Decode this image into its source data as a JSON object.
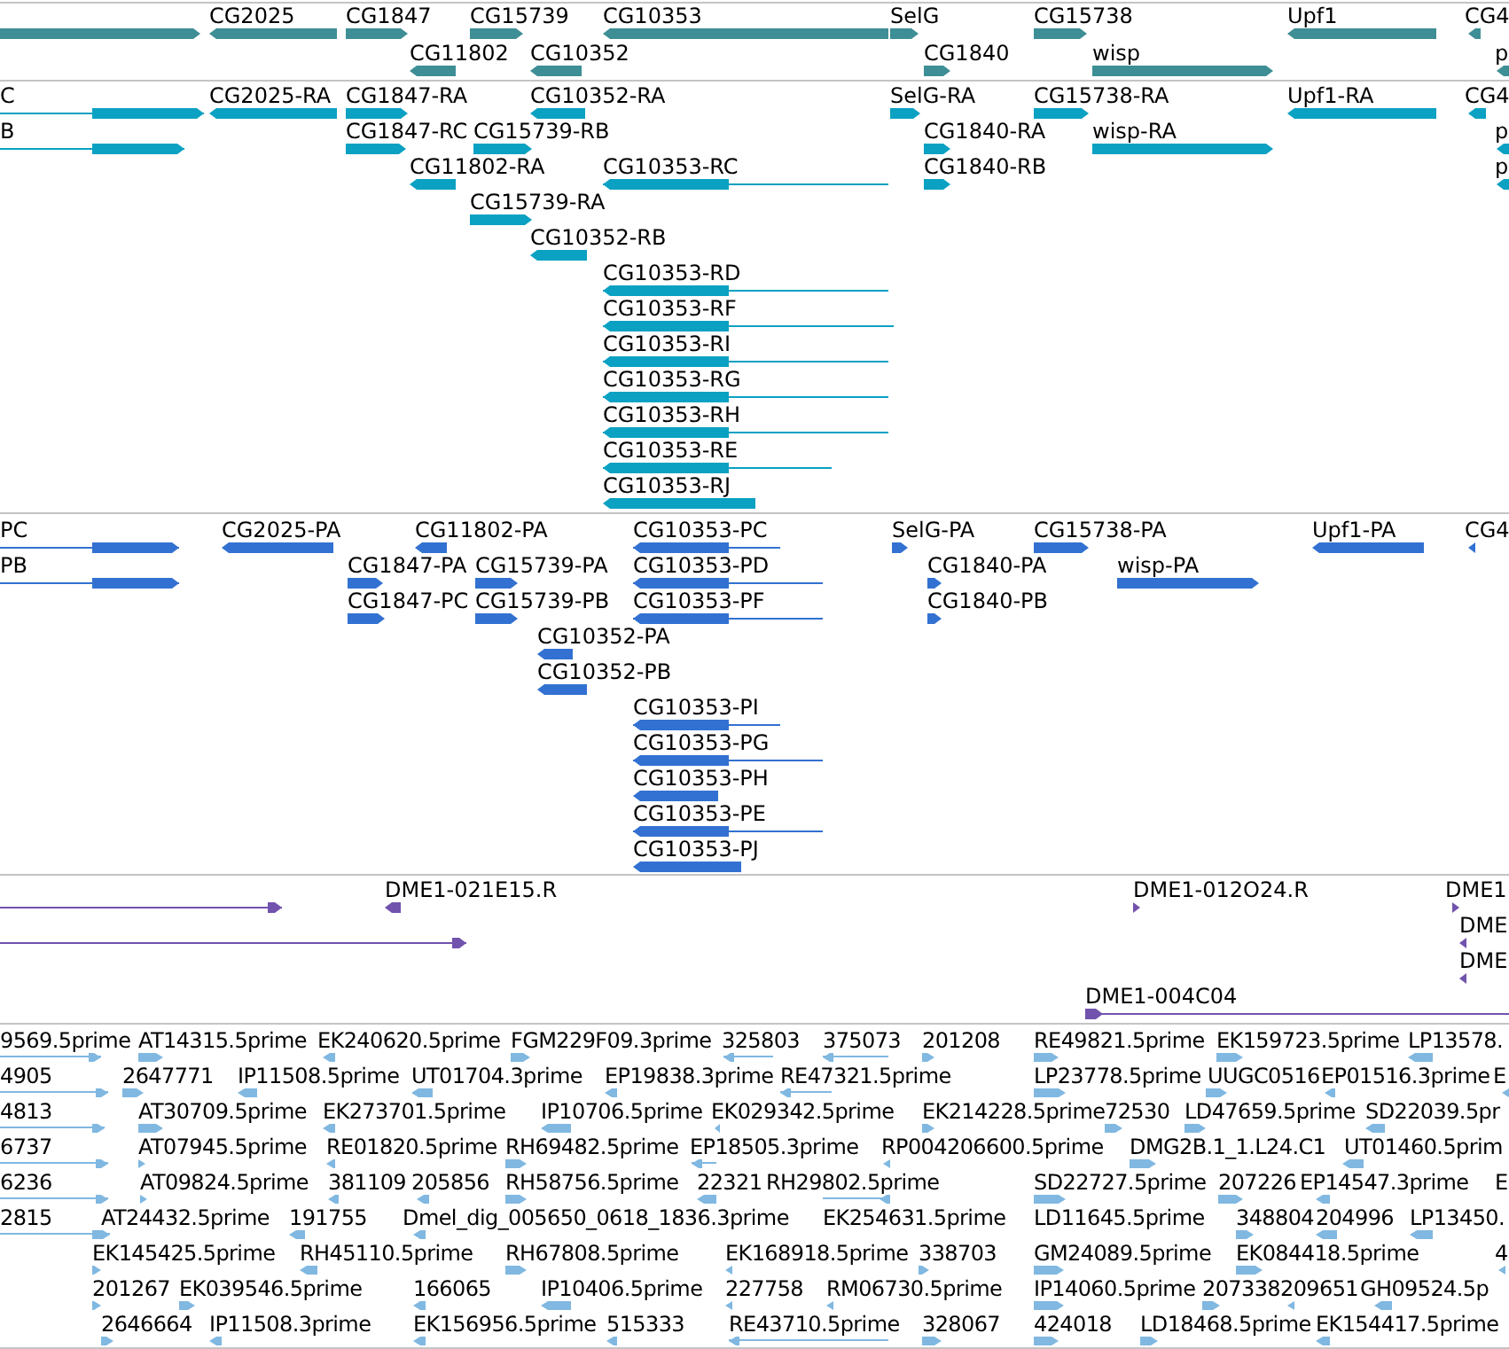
{
  "tracks": [
    {
      "kind": "gene",
      "rows": [
        {
          "features": [
            {
              "reverse": false
            },
            {
              "label": "CG2025",
              "reverse": true
            },
            {
              "label": "CG1847",
              "reverse": false
            },
            {
              "label": "CG15739",
              "reverse": false
            },
            {
              "label": "CG10353",
              "reverse": true
            },
            {
              "label": "SelG",
              "reverse": false
            },
            {
              "label": "CG15738",
              "reverse": false
            },
            {
              "label": "Upf1",
              "reverse": true
            },
            {
              "label": "CG4",
              "reverse": true
            }
          ]
        },
        {
          "features": [
            {
              "label": "CG11802",
              "reverse": true
            },
            {
              "label": "CG10352",
              "reverse": true
            },
            {
              "label": "CG1840",
              "reverse": false
            },
            {
              "label": "wisp",
              "reverse": false
            },
            {
              "label": "p",
              "reverse": true
            }
          ]
        }
      ]
    },
    {
      "kind": "transcript",
      "rows": [
        {
          "features": [
            {
              "label": "C",
              "reverse": false
            },
            {
              "label": "CG2025-RA",
              "reverse": true
            },
            {
              "label": "CG1847-RA",
              "reverse": false
            },
            {
              "label": "CG10352-RA",
              "reverse": true
            },
            {
              "label": "SelG-RA",
              "reverse": false
            },
            {
              "label": "CG15738-RA",
              "reverse": false
            },
            {
              "label": "Upf1-RA",
              "reverse": true
            },
            {
              "label": "CG4",
              "reverse": true
            }
          ]
        },
        {
          "features": [
            {
              "label": "B",
              "reverse": false
            },
            {
              "label": "CG1847-RC",
              "reverse": false
            },
            {
              "label": "CG15739-RB",
              "reverse": false
            },
            {
              "label": "CG1840-RA",
              "reverse": false
            },
            {
              "label": "wisp-RA",
              "reverse": false
            },
            {
              "label": "p",
              "reverse": true
            }
          ]
        },
        {
          "features": [
            {
              "label": "CG11802-RA",
              "reverse": true
            },
            {
              "label": "CG10353-RC",
              "reverse": true
            },
            {
              "label": "CG1840-RB",
              "reverse": false
            },
            {
              "label": "p",
              "reverse": true
            }
          ]
        },
        {
          "features": [
            {
              "label": "CG15739-RA",
              "reverse": false
            }
          ]
        },
        {
          "features": [
            {
              "label": "CG10352-RB",
              "reverse": true
            }
          ]
        },
        {
          "features": [
            {
              "label": "CG10353-RD",
              "reverse": true
            }
          ]
        },
        {
          "features": [
            {
              "label": "CG10353-RF",
              "reverse": true
            }
          ]
        },
        {
          "features": [
            {
              "label": "CG10353-RI",
              "reverse": true
            }
          ]
        },
        {
          "features": [
            {
              "label": "CG10353-RG",
              "reverse": true
            }
          ]
        },
        {
          "features": [
            {
              "label": "CG10353-RH",
              "reverse": true
            }
          ]
        },
        {
          "features": [
            {
              "label": "CG10353-RE",
              "reverse": true
            }
          ]
        },
        {
          "features": [
            {
              "label": "CG10353-RJ",
              "reverse": true
            }
          ]
        }
      ]
    },
    {
      "kind": "protein",
      "rows": [
        {
          "features": [
            {
              "label": "PC",
              "reverse": false
            },
            {
              "label": "CG2025-PA",
              "reverse": true
            },
            {
              "label": "CG11802-PA",
              "reverse": true
            },
            {
              "label": "CG10353-PC",
              "reverse": true
            },
            {
              "label": "SelG-PA",
              "reverse": false
            },
            {
              "label": "CG15738-PA",
              "reverse": false
            },
            {
              "label": "Upf1-PA",
              "reverse": true
            },
            {
              "label": "CG4",
              "reverse": true
            }
          ]
        },
        {
          "features": [
            {
              "label": "PB",
              "reverse": false
            },
            {
              "label": "CG1847-PA",
              "reverse": false
            },
            {
              "label": "CG15739-PA",
              "reverse": false
            },
            {
              "label": "CG10353-PD",
              "reverse": true
            },
            {
              "label": "CG1840-PA",
              "reverse": false
            },
            {
              "label": "wisp-PA",
              "reverse": false
            }
          ]
        },
        {
          "features": [
            {
              "label": "CG1847-PC",
              "reverse": false
            },
            {
              "label": "CG15739-PB",
              "reverse": false
            },
            {
              "label": "CG10353-PF",
              "reverse": true
            },
            {
              "label": "CG1840-PB",
              "reverse": false
            }
          ]
        },
        {
          "features": [
            {
              "label": "CG10352-PA",
              "reverse": true
            }
          ]
        },
        {
          "features": [
            {
              "label": "CG10352-PB",
              "reverse": true
            }
          ]
        },
        {
          "features": [
            {
              "label": "CG10353-PI",
              "reverse": true
            }
          ]
        },
        {
          "features": [
            {
              "label": "CG10353-PG",
              "reverse": true
            }
          ]
        },
        {
          "features": [
            {
              "label": "CG10353-PH",
              "reverse": true
            }
          ]
        },
        {
          "features": [
            {
              "label": "CG10353-PE",
              "reverse": true
            }
          ]
        },
        {
          "features": [
            {
              "label": "CG10353-PJ",
              "reverse": true
            }
          ]
        }
      ]
    },
    {
      "kind": "clone_end",
      "rows": [
        {
          "features": [
            {
              "reverse": false
            },
            {
              "label": "DME1-021E15.R",
              "reverse": true
            },
            {
              "label": "DME1-012O24.R",
              "reverse": false
            },
            {
              "label": "DME1",
              "reverse": false
            }
          ]
        },
        {
          "features": [
            {
              "reverse": false
            },
            {
              "label": "DME",
              "reverse": true
            }
          ]
        },
        {
          "features": [
            {
              "label": "DME",
              "reverse": true
            }
          ]
        },
        {
          "features": [
            {
              "label": "DME1-004C04",
              "reverse": false
            }
          ]
        }
      ]
    },
    {
      "kind": "est",
      "rows": [
        {
          "features": [
            {
              "label": "9569.5prime",
              "reverse": false
            },
            {
              "label": "AT14315.5prime",
              "reverse": false
            },
            {
              "label": "EK240620.5prime",
              "reverse": true
            },
            {
              "label": "FGM229F09.3prime",
              "reverse": false
            },
            {
              "label": "325803",
              "reverse": true
            },
            {
              "label": "375073",
              "reverse": true
            },
            {
              "label": "201208",
              "reverse": false
            },
            {
              "label": "RE49821.5prime",
              "reverse": false
            },
            {
              "label": "EK159723.5prime",
              "reverse": false
            },
            {
              "label": "LP13578.",
              "reverse": true
            }
          ]
        },
        {
          "features": [
            {
              "label": "4905",
              "reverse": false
            },
            {
              "label": "2647771",
              "reverse": false
            },
            {
              "label": "IP11508.5prime",
              "reverse": true
            },
            {
              "label": "UT01704.3prime",
              "reverse": true
            },
            {
              "label": "EP19838.3prime",
              "reverse": true
            },
            {
              "label": "RE47321.5prime",
              "reverse": true
            },
            {
              "label": "LP23778.5prime",
              "reverse": false
            },
            {
              "label": "UUGC0516",
              "reverse": false
            },
            {
              "label": "EP01516.3prime",
              "reverse": true
            },
            {
              "label": "E",
              "reverse": true
            }
          ]
        },
        {
          "features": [
            {
              "label": "4813",
              "reverse": false
            },
            {
              "label": "AT30709.5prime",
              "reverse": false
            },
            {
              "label": "EK273701.5prime",
              "reverse": true
            },
            {
              "label": "IP10706.5prime",
              "reverse": true
            },
            {
              "label": "EK029342.5prime",
              "reverse": true
            },
            {
              "label": "EK214228.5prime",
              "reverse": false
            },
            {
              "label": "72530",
              "reverse": false
            },
            {
              "label": "LD47659.5prime",
              "reverse": false
            },
            {
              "label": "SD22039.5pr",
              "reverse": true
            }
          ]
        },
        {
          "features": [
            {
              "label": "6737",
              "reverse": false
            },
            {
              "label": "AT07945.5prime",
              "reverse": false
            },
            {
              "label": "RE01820.5prime",
              "reverse": true
            },
            {
              "label": "RH69482.5prime",
              "reverse": false
            },
            {
              "label": "EP18505.3prime",
              "reverse": true
            },
            {
              "label": "RP004206600.5prime",
              "reverse": true
            },
            {
              "label": "DMG2B.1_1.L24.C1",
              "reverse": false
            },
            {
              "label": "UT01460.5prim",
              "reverse": true
            }
          ]
        },
        {
          "features": [
            {
              "label": "6236",
              "reverse": false
            },
            {
              "label": "AT09824.5prime",
              "reverse": false
            },
            {
              "label": "381109",
              "reverse": true
            },
            {
              "label": "205856",
              "reverse": true
            },
            {
              "label": "RH58756.5prime",
              "reverse": false
            },
            {
              "label": "22321",
              "reverse": true
            },
            {
              "label": "RH29802.5prime",
              "reverse": true
            },
            {
              "label": "SD22727.5prime",
              "reverse": false
            },
            {
              "label": "207226",
              "reverse": false
            },
            {
              "label": "EP14547.3prime",
              "reverse": true
            },
            {
              "label": "E"
            }
          ]
        },
        {
          "features": [
            {
              "label": "2815",
              "reverse": false
            },
            {
              "label": "AT24432.5prime"
            },
            {
              "label": "191755",
              "reverse": true
            },
            {
              "label": "Dmel_dig_005650_0618_1836.3prime",
              "reverse": true
            },
            {
              "label": "EK254631.5prime"
            },
            {
              "label": "LD11645.5prime"
            },
            {
              "label": "348804",
              "reverse": false
            },
            {
              "label": "204996",
              "reverse": true
            },
            {
              "label": "LP13450.",
              "reverse": true
            }
          ]
        },
        {
          "features": [
            {
              "label": "EK145425.5prime",
              "reverse": false
            },
            {
              "label": "RH45110.5prime",
              "reverse": true
            },
            {
              "label": "RH67808.5prime",
              "reverse": false
            },
            {
              "label": "EK168918.5prime",
              "reverse": true
            },
            {
              "label": "338703",
              "reverse": false
            },
            {
              "label": "GM24089.5prime",
              "reverse": false
            },
            {
              "label": "EK084418.5prime",
              "reverse": false
            },
            {
              "label": "4",
              "reverse": true
            }
          ]
        },
        {
          "features": [
            {
              "label": "201267",
              "reverse": false
            },
            {
              "label": "EK039546.5prime",
              "reverse": false
            },
            {
              "label": "166065",
              "reverse": true
            },
            {
              "label": "IP10406.5prime",
              "reverse": true
            },
            {
              "label": "227758",
              "reverse": true
            },
            {
              "label": "RM06730.5prime",
              "reverse": true
            },
            {
              "label": "IP14060.5prime",
              "reverse": false
            },
            {
              "label": "207338",
              "reverse": false
            },
            {
              "label": "209651",
              "reverse": true
            },
            {
              "label": "GH09524.5p",
              "reverse": true
            }
          ]
        },
        {
          "features": [
            {
              "label": "2646664",
              "reverse": false
            },
            {
              "label": "IP11508.3prime",
              "reverse": true
            },
            {
              "label": "EK156956.5prime",
              "reverse": true
            },
            {
              "label": "515333",
              "reverse": true
            },
            {
              "label": "RE43710.5prime",
              "reverse": true
            },
            {
              "label": "328067",
              "reverse": false
            },
            {
              "label": "424018",
              "reverse": false
            },
            {
              "label": "LD18468.5prime",
              "reverse": false
            },
            {
              "label": "EK154417.5prime",
              "reverse": true
            }
          ]
        }
      ]
    }
  ]
}
